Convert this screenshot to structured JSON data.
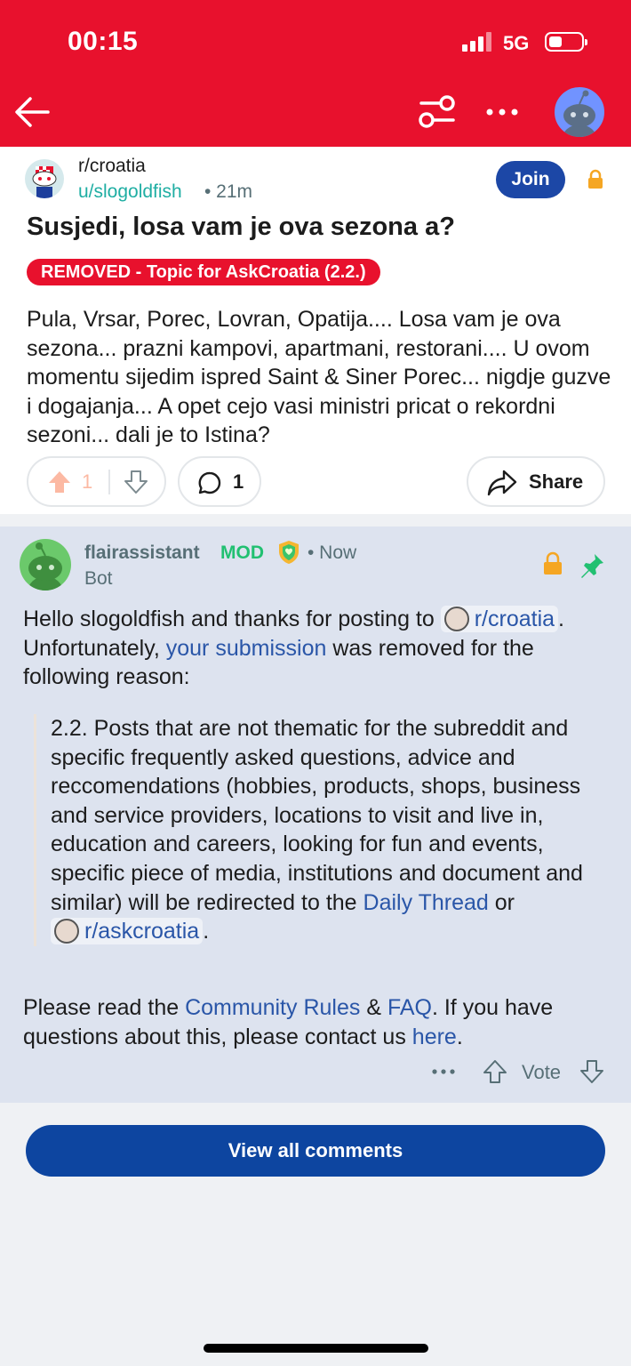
{
  "status_bar": {
    "time": "00:15",
    "network": "5G"
  },
  "header": {
    "back_icon": "arrow-left-icon",
    "filter_icon": "sort-filter-icon",
    "more_icon": "more-horizontal-icon",
    "avatar_icon": "snoo-avatar-icon"
  },
  "post": {
    "subreddit": "r/croatia",
    "author": "u/slogoldfish",
    "time": "• 21m",
    "join_label": "Join",
    "title": "Susjedi, losa vam je ova sezona a?",
    "removed_badge": "REMOVED - Topic for AskCroatia (2.2.)",
    "body": "Pula, Vrsar, Porec, Lovran, Opatija.... Losa vam je ova sezona... prazni kampovi, apartmani, restorani.... U ovom momentu sijedim ispred Saint & Siner Porec... nigdje guzve i dogajanja... A opet cejo vasi ministri pricat o rekordni sezoni... dali je to Istina?",
    "upvotes": "1",
    "comments": "1",
    "share_label": "Share"
  },
  "comment": {
    "user": "flairassistant",
    "mod_label": "MOD",
    "time": "• Now",
    "bot_label": "Bot",
    "p1_a": "Hello slogoldfish and thanks for posting to",
    "p1_link1": "r/croatia",
    "p1_b": ". Unfortunately,",
    "p1_link2": "your submission",
    "p1_c": "was removed for the following reason:",
    "quote_a": "2.2. Posts that are not thematic for the subreddit and specific frequently asked questions, advice and reccomendations (hobbies, products, shops, business and service providers, locations to visit and live in, education and careers, looking for fun and events, specific piece of media, institutions and document and similar) will be redirected to the",
    "quote_link1": "Daily Thread",
    "quote_or": "or",
    "quote_link2": "r/askcroatia",
    "quote_end": ".",
    "p2_a": "Please read the",
    "p2_link1": "Community Rules",
    "p2_amp": "&",
    "p2_link2": "FAQ",
    "p2_b": ". If you have questions about this, please contact us",
    "p2_link3": "here",
    "p2_end": ".",
    "vote_label": "Vote"
  },
  "view_all_label": "View all comments",
  "colors": {
    "header": "#e8112d",
    "join": "#1c47a6",
    "link": "#2a56a8",
    "mod": "#21c071",
    "author": "#1faea3",
    "view_all": "#0d45a0",
    "comment_bg": "#dde3ef"
  }
}
